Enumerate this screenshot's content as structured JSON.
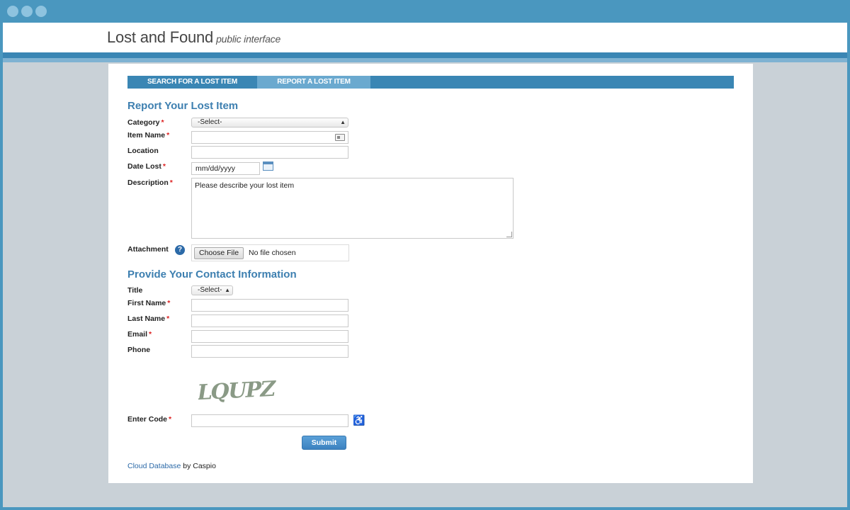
{
  "header": {
    "title": "Lost and Found",
    "subtitle": "public interface"
  },
  "tabs": [
    {
      "label": "SEARCH FOR A LOST ITEM"
    },
    {
      "label": "REPORT A LOST ITEM"
    }
  ],
  "report_section": {
    "title": "Report Your Lost Item",
    "category_label": "Category",
    "category_value": "-Select-",
    "item_name_label": "Item Name",
    "location_label": "Location",
    "date_lost_label": "Date Lost",
    "date_lost_value": "mm/dd/yyyy",
    "description_label": "Description",
    "description_value": "Please describe your lost item",
    "attachment_label": "Attachment",
    "file_button": "Choose File",
    "file_status": "No file chosen"
  },
  "contact_section": {
    "title": "Provide Your Contact Information",
    "title_label": "Title",
    "title_value": "-Select-",
    "first_name_label": "First Name",
    "last_name_label": "Last Name",
    "email_label": "Email",
    "phone_label": "Phone"
  },
  "captcha": {
    "code": "LQUPZ",
    "enter_code_label": "Enter Code"
  },
  "submit_label": "Submit",
  "footer": {
    "link_text": "Cloud Database",
    "suffix": " by Caspio"
  },
  "required_marker": "*",
  "colors": {
    "accent": "#3a86b4",
    "section_title": "#3d7fb0",
    "required": "#dd2222",
    "submit": "#4a90cc"
  }
}
